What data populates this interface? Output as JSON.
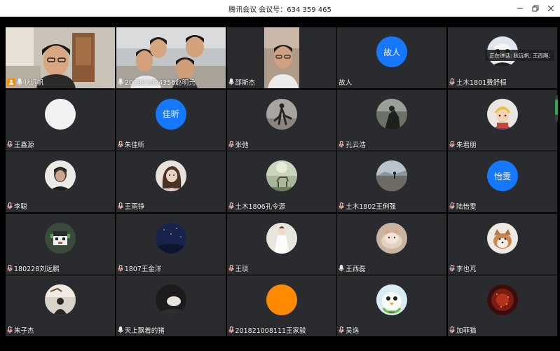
{
  "window": {
    "title": "腾讯会议 会议号：634 359 465",
    "min_icon": "minimize-icon",
    "restore_icon": "restore-icon",
    "close_icon": "close-icon"
  },
  "speaking": {
    "label": "正在讲话:",
    "names": "狄远帆; 王西飚;"
  },
  "colors": {
    "tile_bg": "#2a2b2f",
    "avatar_blue": "#1677ff",
    "avatar_orange": "#ff8a00",
    "host_orange": "#ff8a00",
    "active_green": "#33a852"
  },
  "participants": [
    {
      "name": "狄远帆",
      "host": true,
      "mic": "on",
      "kind": "video"
    },
    {
      "name": "201821024356赵明元",
      "host": false,
      "mic": "on",
      "kind": "video"
    },
    {
      "name": "邵斯杰",
      "host": false,
      "mic": "on",
      "kind": "video"
    },
    {
      "name": "故人",
      "host": false,
      "mic": "none",
      "kind": "initials",
      "initials": "故人"
    },
    {
      "name": "土木1801费舒桓",
      "host": false,
      "mic": "muted",
      "kind": "photo"
    },
    {
      "name": "王鑫源",
      "host": false,
      "mic": "muted",
      "kind": "blank"
    },
    {
      "name": "朱佳昕",
      "host": false,
      "mic": "muted",
      "kind": "initials",
      "initials": "佳昕"
    },
    {
      "name": "张弛",
      "host": false,
      "mic": "muted",
      "kind": "photo"
    },
    {
      "name": "孔云浩",
      "host": false,
      "mic": "muted",
      "kind": "photo"
    },
    {
      "name": "朱君朋",
      "host": false,
      "mic": "muted",
      "kind": "photo"
    },
    {
      "name": "李聪",
      "host": false,
      "mic": "muted",
      "kind": "photo"
    },
    {
      "name": "王雨铮",
      "host": false,
      "mic": "muted",
      "kind": "photo"
    },
    {
      "name": "土木1806孔令源",
      "host": false,
      "mic": "muted",
      "kind": "photo"
    },
    {
      "name": "土木1802王俐强",
      "host": false,
      "mic": "muted",
      "kind": "photo"
    },
    {
      "name": "陆怡雯",
      "host": false,
      "mic": "muted",
      "kind": "initials",
      "initials": "怡雯"
    },
    {
      "name": "180228刘远鹏",
      "host": false,
      "mic": "muted",
      "kind": "photo"
    },
    {
      "name": "1807王金洋",
      "host": false,
      "mic": "muted",
      "kind": "photo"
    },
    {
      "name": "王琰",
      "host": false,
      "mic": "muted",
      "kind": "photo"
    },
    {
      "name": "王西磊",
      "host": false,
      "mic": "on",
      "kind": "photo"
    },
    {
      "name": "李也芃",
      "host": false,
      "mic": "muted",
      "kind": "photo"
    },
    {
      "name": "朱子杰",
      "host": false,
      "mic": "muted",
      "kind": "photo"
    },
    {
      "name": "天上飘着的猪",
      "host": false,
      "mic": "on",
      "kind": "photo"
    },
    {
      "name": "201821008111王家骏",
      "host": false,
      "mic": "muted",
      "kind": "orange"
    },
    {
      "name": "吴逸",
      "host": false,
      "mic": "muted",
      "kind": "photo"
    },
    {
      "name": "加菲猫",
      "host": false,
      "mic": "muted",
      "kind": "photo"
    }
  ]
}
